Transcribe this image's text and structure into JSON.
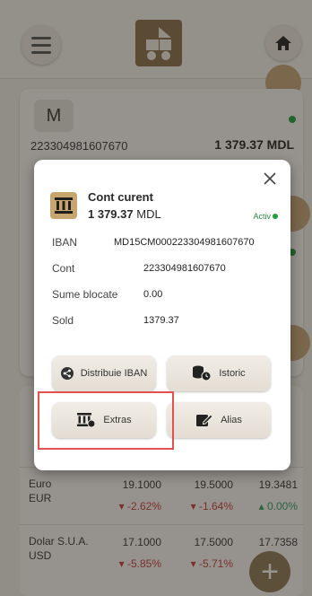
{
  "background": {
    "account": {
      "avatar_letter": "M",
      "number": "223304981607670",
      "balance": "1 379.37 MDL"
    },
    "rates": [
      {
        "name": "Euro",
        "code": "EUR",
        "v1": "19.1000",
        "c1": "-2.62%",
        "v2": "19.5000",
        "c2": "-1.64%",
        "v3": "19.3481",
        "c3": "0.00%"
      },
      {
        "name": "Dolar S.U.A.",
        "code": "USD",
        "v1": "17.1000",
        "c1": "-5.85%",
        "v2": "17.5000",
        "c2": "-5.71%",
        "v3": "17.7358",
        "c3": ""
      }
    ]
  },
  "modal": {
    "title": "Cont curent",
    "balance_amount": "1 379.37",
    "balance_currency": "MDL",
    "status": "Activ",
    "fields": [
      {
        "label": "IBAN",
        "value": "MD15CM000223304981607670"
      },
      {
        "label": "Cont",
        "value": "223304981607670"
      },
      {
        "label": "Sume blocate",
        "value": "0.00"
      },
      {
        "label": "Sold",
        "value": "1379.37"
      }
    ],
    "buttons": {
      "share_iban": "Distribuie IBAN",
      "history": "Istoric",
      "statement": "Extras",
      "alias": "Alias"
    }
  },
  "colors": {
    "accent": "#c8a56e",
    "status_green": "#22a03a",
    "highlight": "#e25050"
  }
}
